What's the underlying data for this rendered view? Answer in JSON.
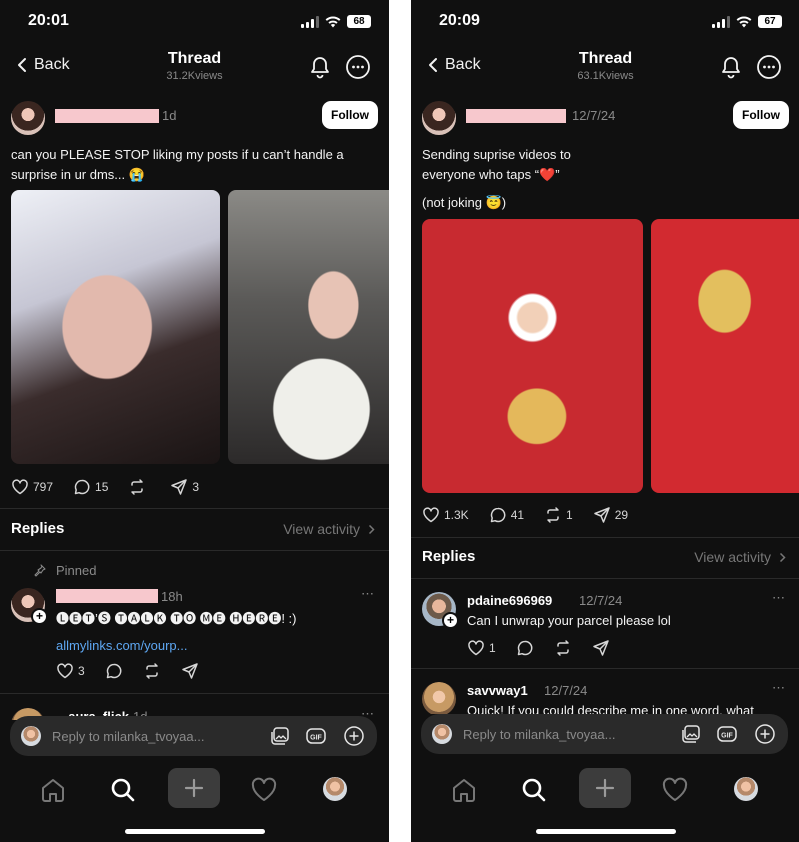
{
  "left": {
    "status": {
      "time": "20:01",
      "battery": "68"
    },
    "header": {
      "back_label": "Back",
      "title": "Thread",
      "views": "31.2Kviews"
    },
    "post": {
      "time": "1d",
      "follow_label": "Follow",
      "text": "can you PLEASE STOP liking my posts if u can’t handle a surprise in ur dms... 😭",
      "likes": "797",
      "comments": "15",
      "reposts": "",
      "shares": "3"
    },
    "replies": {
      "title": "Replies",
      "view_activity": "View activity",
      "pinned_label": "Pinned",
      "pinned_reply": {
        "time": "18h",
        "text": "🅛🅔🅣’🅢 🅣🅐🅛🅚 🅣🅞 🅜🅔 🅗🅔🅡🅔! :)",
        "link": "allmylinks.com/yourp...",
        "likes": "3"
      },
      "next_reply": {
        "user": "_aura_flick",
        "time": "1d"
      }
    },
    "composer": {
      "placeholder": "Reply to milanka_tvoyaa..."
    }
  },
  "right": {
    "status": {
      "time": "20:09",
      "battery": "67"
    },
    "header": {
      "back_label": "Back",
      "title": "Thread",
      "views": "63.1Kviews"
    },
    "post": {
      "time": "12/7/24",
      "follow_label": "Follow",
      "text_line1": "Sending suprise videos to",
      "text_line2": "everyone who taps “❤️”",
      "text_line3": "(not joking 😇)",
      "likes": "1.3K",
      "comments": "41",
      "reposts": "1",
      "shares": "29"
    },
    "replies": {
      "title": "Replies",
      "view_activity": "View activity",
      "reply1": {
        "user": "pdaine696969",
        "time": "12/7/24",
        "text": "Can I unwrap your parcel please lol",
        "likes": "1"
      },
      "reply2": {
        "user": "savvway1",
        "time": "12/7/24",
        "text": "Quick! If you could describe me in one word, what"
      }
    },
    "composer": {
      "placeholder": "Reply to milanka_tvoyaa..."
    }
  },
  "icons": {
    "more": "⋯"
  }
}
